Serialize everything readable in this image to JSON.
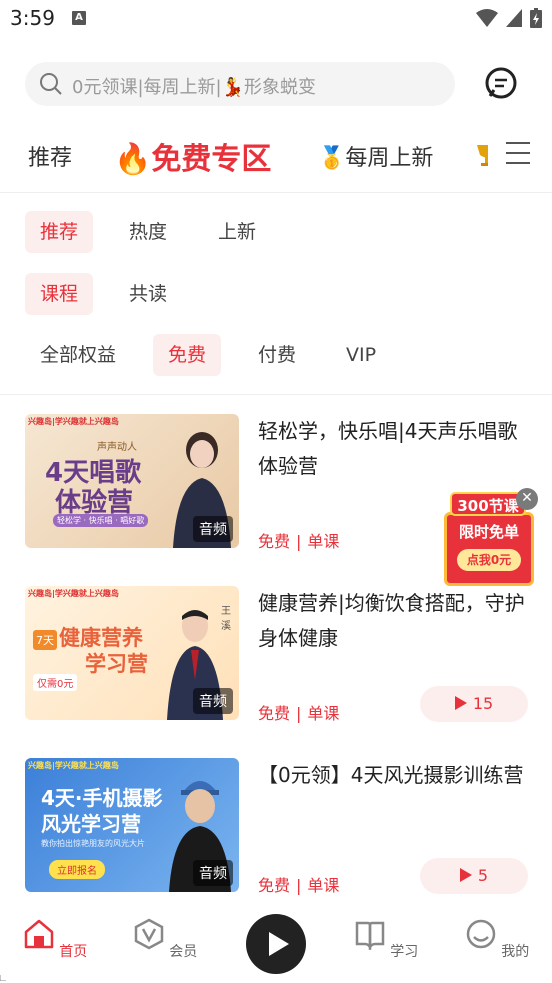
{
  "status": {
    "time": "3:59"
  },
  "search": {
    "placeholder": "0元领课|每周上新|💃形象蜕变"
  },
  "topnav": {
    "tab_recommend": "推荐",
    "tab_free": "🔥免费专区",
    "tab_weekly": "🥇每周上新"
  },
  "filters": {
    "row1": [
      "推荐",
      "热度",
      "上新"
    ],
    "row2": [
      "课程",
      "共读"
    ],
    "row3": [
      "全部权益",
      "免费",
      "付费",
      "VIP"
    ]
  },
  "courses": [
    {
      "title": "轻松学，快乐唱|4天声乐唱歌体验营",
      "price": "免费",
      "type": "单课",
      "plays": "",
      "thumb": {
        "brand": "兴趣岛|学兴趣就上兴趣岛",
        "line1": "声声动人",
        "line2": "4天唱歌",
        "line3": "体验营",
        "sub": "轻松学 · 快乐唱 · 唱好歌",
        "badge": "音频"
      }
    },
    {
      "title": "健康营养|均衡饮食搭配，守护身体健康",
      "price": "免费",
      "type": "单课",
      "plays": "15",
      "thumb": {
        "brand": "兴趣岛|学兴趣就上兴趣岛",
        "line1": "健康营养",
        "line2": "学习营",
        "tag": "7天",
        "price_tag": "仅需0元",
        "teacher": "王溪",
        "badge": "音频"
      }
    },
    {
      "title": "【0元领】4天风光摄影训练营",
      "price": "免费",
      "type": "单课",
      "plays": "5",
      "thumb": {
        "brand": "兴趣岛|学兴趣就上兴趣岛",
        "line1": "4天·手机摄影",
        "line2": "风光学习营",
        "sub": "教你拍出惊艳朋友的风光大片",
        "cta": "立即报名",
        "badge": "音频"
      }
    }
  ],
  "promo": {
    "head": "300节课",
    "line1": "限时免单",
    "line2": "点我0元"
  },
  "bottomnav": {
    "home": "首页",
    "member": "会员",
    "study": "学习",
    "mine": "我的"
  },
  "colors": {
    "accent": "#e8323b",
    "chip_bg": "#fdeeee"
  }
}
